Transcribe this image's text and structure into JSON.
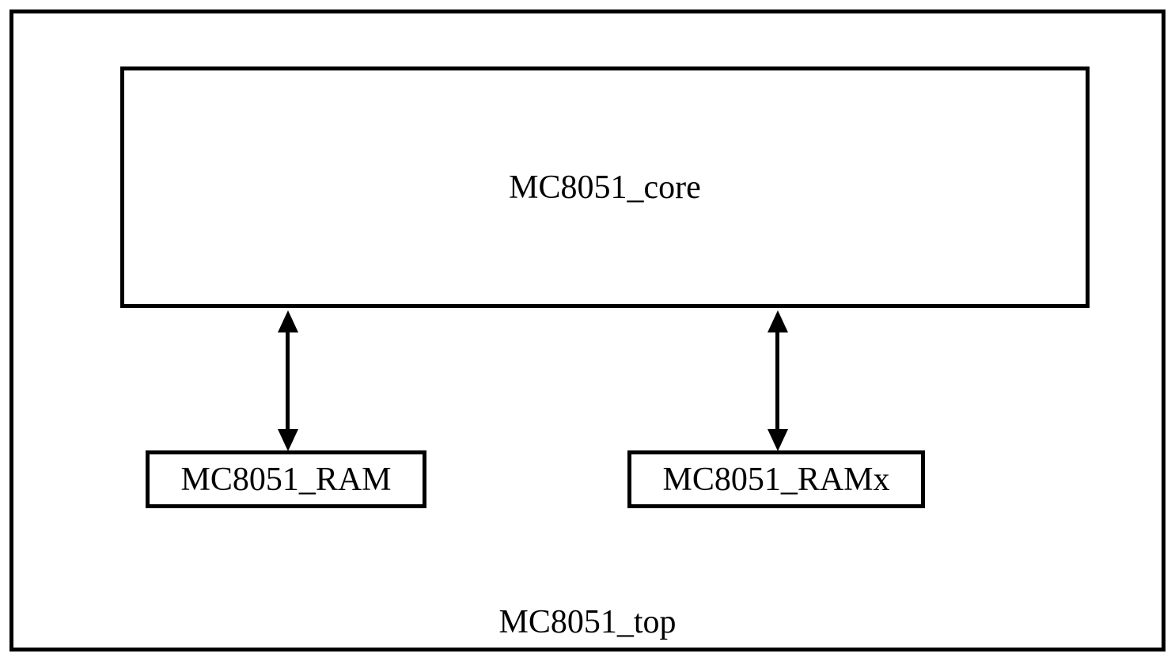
{
  "diagram": {
    "outer_label": "MC8051_top",
    "core_label": "MC8051_core",
    "ram_label": "MC8051_RAM",
    "ramx_label": "MC8051_RAMx"
  }
}
